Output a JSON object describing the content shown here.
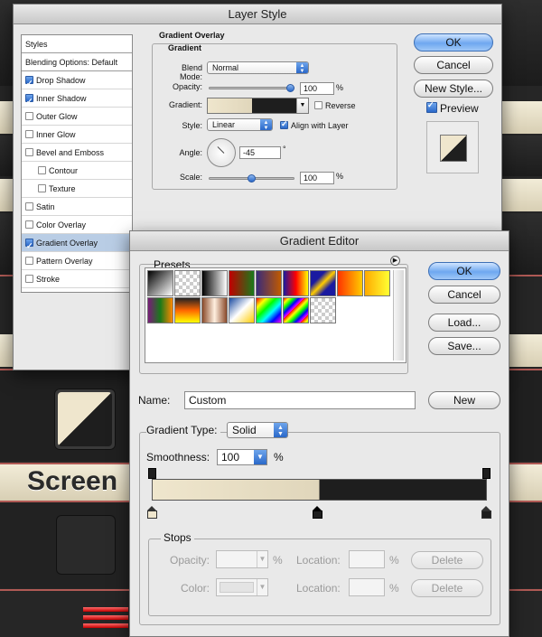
{
  "layer_style": {
    "title": "Layer Style",
    "styles_header": "Styles",
    "blending_options": "Blending Options: Default",
    "items": [
      {
        "label": "Drop Shadow",
        "checked": true,
        "indent": false,
        "selected": false
      },
      {
        "label": "Inner Shadow",
        "checked": true,
        "indent": false,
        "selected": false
      },
      {
        "label": "Outer Glow",
        "checked": false,
        "indent": false,
        "selected": false
      },
      {
        "label": "Inner Glow",
        "checked": false,
        "indent": false,
        "selected": false
      },
      {
        "label": "Bevel and Emboss",
        "checked": false,
        "indent": false,
        "selected": false
      },
      {
        "label": "Contour",
        "checked": false,
        "indent": true,
        "selected": false
      },
      {
        "label": "Texture",
        "checked": false,
        "indent": true,
        "selected": false
      },
      {
        "label": "Satin",
        "checked": false,
        "indent": false,
        "selected": false
      },
      {
        "label": "Color Overlay",
        "checked": false,
        "indent": false,
        "selected": false
      },
      {
        "label": "Gradient Overlay",
        "checked": true,
        "indent": false,
        "selected": true
      },
      {
        "label": "Pattern Overlay",
        "checked": false,
        "indent": false,
        "selected": false
      },
      {
        "label": "Stroke",
        "checked": false,
        "indent": false,
        "selected": false
      }
    ],
    "panel_title": "Gradient Overlay",
    "sub_title": "Gradient",
    "blend_mode_label": "Blend Mode:",
    "blend_mode_value": "Normal",
    "opacity_label": "Opacity:",
    "opacity_value": "100",
    "opacity_unit": "%",
    "opacity_level": 1.0,
    "gradient_label": "Gradient:",
    "reverse_label": "Reverse",
    "reverse_checked": false,
    "style_label": "Style:",
    "style_value": "Linear",
    "align_label": "Align with Layer",
    "align_checked": true,
    "angle_label": "Angle:",
    "angle_value": "-45",
    "angle_unit": "°",
    "scale_label": "Scale:",
    "scale_value": "100",
    "scale_unit": "%",
    "scale_level": 0.5,
    "ok_label": "OK",
    "cancel_label": "Cancel",
    "new_style_label": "New Style...",
    "preview_label": "Preview",
    "preview_checked": true
  },
  "gradient_editor": {
    "title": "Gradient Editor",
    "presets_label": "Presets",
    "ok_label": "OK",
    "cancel_label": "Cancel",
    "load_label": "Load...",
    "save_label": "Save...",
    "name_label": "Name:",
    "name_value": "Custom",
    "new_label": "New",
    "gradient_type_label": "Gradient Type:",
    "gradient_type_value": "Solid",
    "smoothness_label": "Smoothness:",
    "smoothness_value": "100",
    "smoothness_unit": "%",
    "stops_label": "Stops",
    "opacity_label": "Opacity:",
    "location_label": "Location:",
    "color_label": "Color:",
    "percent": "%",
    "delete_label": "Delete"
  },
  "background": {
    "screen_text": "Screen"
  },
  "colors": {
    "cream": "#efe6cd",
    "dark": "#1e1e1e",
    "accent_blue": "#2a68c9",
    "selected_row": "#b9cde5"
  },
  "presets": [
    "linear-gradient(135deg,#000,#fff)",
    "checker-fg",
    "linear-gradient(90deg,#000,#fff)",
    "linear-gradient(90deg,#c00000,#1a7a1a)",
    "linear-gradient(90deg,#3a2a7a,#c05a00)",
    "linear-gradient(90deg,#1a1aa0,#ff0000,#ffff00)",
    "linear-gradient(135deg,#1a1aa0 30%,#ffcc00 50%,#1a1aa0 70%)",
    "linear-gradient(90deg,#ff3300,#ffcc00)",
    "linear-gradient(90deg,#ffaa00,#ffff33)",
    "linear-gradient(90deg,#7a1a7a,#1a7a1a,#ff8800)",
    "linear-gradient(180deg,#222,#ff6600 50%,#ffff00)",
    "linear-gradient(90deg,#8a4a2a,#fff0e0,#8a4a2a)",
    "linear-gradient(135deg,#1a4aa0,#ffffff 50%,#ffcc00)",
    "linear-gradient(135deg,#ff0000,#ffff00,#00ff00,#00ffff,#0000ff,#ff00ff)",
    "repeating-linear-gradient(135deg,#ff0000 0,#ffff00 4px,#00ff00 8px,#0000ff 12px,#ff00ff 16px)",
    "checker"
  ]
}
